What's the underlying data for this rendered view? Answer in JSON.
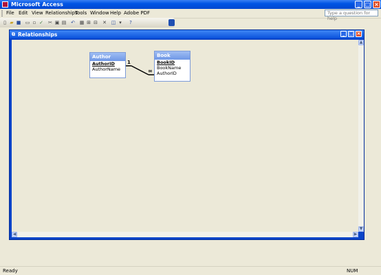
{
  "window": {
    "title": "Microsoft Access",
    "controls": [
      "minimize-icon",
      "maximize-icon",
      "close-icon"
    ]
  },
  "menu": {
    "items": [
      "File",
      "Edit",
      "View",
      "Relationships",
      "Tools",
      "Window",
      "Help",
      "Adobe PDF"
    ],
    "help_placeholder": "Type a question for help"
  },
  "toolbar": {
    "icons": [
      "new-icon",
      "open-icon",
      "save-icon",
      "print-icon",
      "preview-icon",
      "spelling-icon",
      "cut-icon",
      "copy-icon",
      "paste-icon",
      "undo-icon",
      "show-table-icon",
      "direct-relationships-icon",
      "all-relationships-icon",
      "delete-icon",
      "database-window-icon",
      "new-object-icon",
      "help-icon"
    ]
  },
  "child_window": {
    "title": "Relationships"
  },
  "tables": [
    {
      "name": "Author",
      "fields": [
        {
          "name": "AuthorID",
          "primary_key": true
        },
        {
          "name": "AuthorName",
          "primary_key": false
        }
      ]
    },
    {
      "name": "Book",
      "fields": [
        {
          "name": "BookID",
          "primary_key": true
        },
        {
          "name": "BookName",
          "primary_key": false
        },
        {
          "name": "AuthorID",
          "primary_key": false
        }
      ]
    }
  ],
  "relationship": {
    "from_table": "Author",
    "from_field": "AuthorID",
    "from_label": "1",
    "to_table": "Book",
    "to_field": "AuthorID",
    "to_label": "∞"
  },
  "status": {
    "text": "Ready",
    "num": "NUM"
  },
  "colors": {
    "title_bar": "#0055e5",
    "table_header": "#7f9ee6",
    "canvas": "#ece9d8"
  }
}
